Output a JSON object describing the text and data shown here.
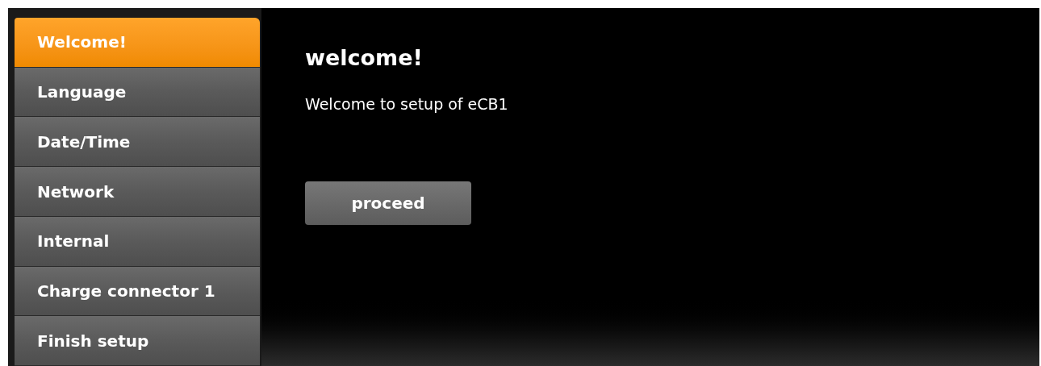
{
  "sidebar": {
    "items": [
      {
        "label": "Welcome!",
        "selected": true
      },
      {
        "label": "Language",
        "selected": false
      },
      {
        "label": "Date/Time",
        "selected": false
      },
      {
        "label": "Network",
        "selected": false
      },
      {
        "label": "Internal",
        "selected": false
      },
      {
        "label": "Charge connector 1",
        "selected": false
      },
      {
        "label": "Finish setup",
        "selected": false
      }
    ]
  },
  "content": {
    "title": "welcome!",
    "message": "Welcome to setup of eCB1",
    "button": "proceed"
  }
}
